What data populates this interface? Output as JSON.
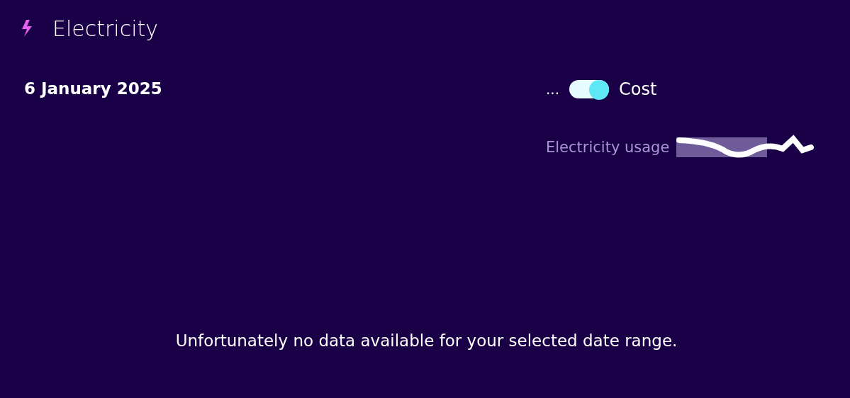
{
  "section": {
    "title": "Electricity"
  },
  "date": "6 January 2025",
  "toggle": {
    "left_label": "...",
    "on": true,
    "right_label": "Cost"
  },
  "usage": {
    "label": "Electricity usage"
  },
  "message": "Unfortunately no data available for your selected date range."
}
